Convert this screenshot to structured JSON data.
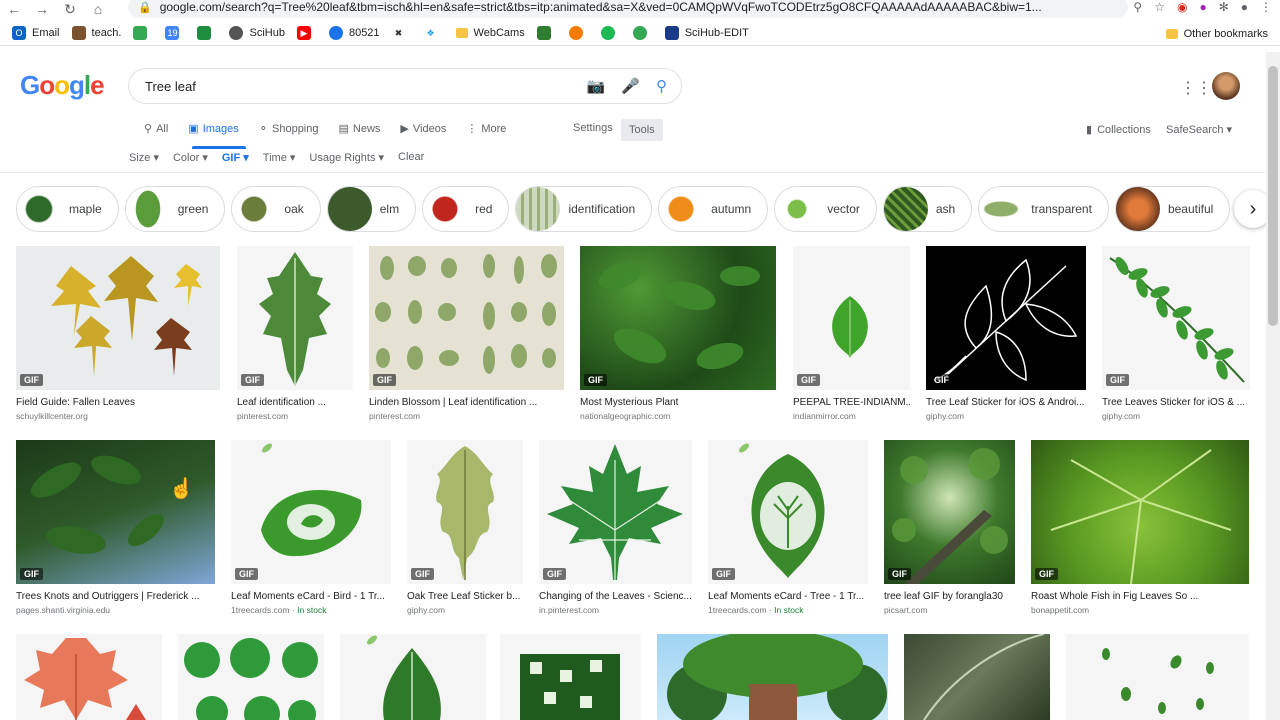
{
  "browser": {
    "url": "google.com/search?q=Tree%20leaf&tbm=isch&hl=en&safe=strict&tbs=itp:animated&sa=X&ved=0CAMQpWVqFwoTCODEtrz5gO8CFQAAAAAdAAAAABAC&biw=1...",
    "bookmarks": [
      "Email",
      "teach.",
      "",
      "",
      "",
      "SciHub",
      "",
      "80521",
      "",
      "",
      "WebCams",
      "",
      "",
      "",
      "",
      "SciHub-EDIT"
    ],
    "other_bookmarks": "Other bookmarks"
  },
  "google": {
    "logo": "Google",
    "query": "Tree leaf",
    "tabs": [
      "All",
      "Images",
      "Shopping",
      "News",
      "Videos",
      "More"
    ],
    "settings": "Settings",
    "tools": "Tools",
    "collections": "Collections",
    "safesearch": "SafeSearch ▾",
    "filters": [
      "Size ▾",
      "Color ▾",
      "GIF ▾",
      "Time ▾",
      "Usage Rights ▾",
      "Clear"
    ]
  },
  "chips": [
    "maple",
    "green",
    "oak",
    "elm",
    "red",
    "identification",
    "autumn",
    "vector",
    "ash",
    "transparent",
    "beautiful"
  ],
  "row1": [
    {
      "caption": "Field Guide: Fallen Leaves",
      "source": "schuylkillcenter.org",
      "badge": "GIF"
    },
    {
      "caption": "Leaf identification ...",
      "source": "pinterest.com",
      "badge": "GIF"
    },
    {
      "caption": "Linden Blossom | Leaf identification ...",
      "source": "pinterest.com",
      "badge": "GIF"
    },
    {
      "caption": "Most Mysterious Plant",
      "source": "nationalgeographic.com",
      "badge": "GIF"
    },
    {
      "caption": "PEEPAL TREE-INDIANM...",
      "source": "indianmirror.com",
      "badge": "GIF"
    },
    {
      "caption": "Tree Leaf Sticker for iOS & Androi...",
      "source": "giphy.com",
      "badge": "GIF"
    },
    {
      "caption": "Tree Leaves Sticker for iOS & ...",
      "source": "giphy.com",
      "badge": "GIF"
    }
  ],
  "row2": [
    {
      "caption": "Trees Knots and Outriggers | Frederick ...",
      "source": "pages.shanti.virginia.edu",
      "badge": "GIF",
      "stock": ""
    },
    {
      "caption": "Leaf Moments eCard - Bird - 1 Tr...",
      "source": "1treecards.com",
      "badge": "GIF",
      "stock": "In stock"
    },
    {
      "caption": "Oak Tree Leaf Sticker b...",
      "source": "giphy.com",
      "badge": "GIF",
      "stock": ""
    },
    {
      "caption": "Changing of the Leaves - Scienc...",
      "source": "in.pinterest.com",
      "badge": "GIF",
      "stock": ""
    },
    {
      "caption": "Leaf Moments eCard - Tree - 1 Tr...",
      "source": "1treecards.com",
      "badge": "GIF",
      "stock": "In stock"
    },
    {
      "caption": "tree leaf GIF by forangla30",
      "source": "picsart.com",
      "badge": "GIF",
      "stock": ""
    },
    {
      "caption": "Roast Whole Fish in Fig Leaves So ...",
      "source": "bonappetit.com",
      "badge": "GIF",
      "stock": ""
    }
  ],
  "colors": {
    "accent": "#1a73e8",
    "stock": "#188038",
    "leaf": "#2e8b3a"
  }
}
